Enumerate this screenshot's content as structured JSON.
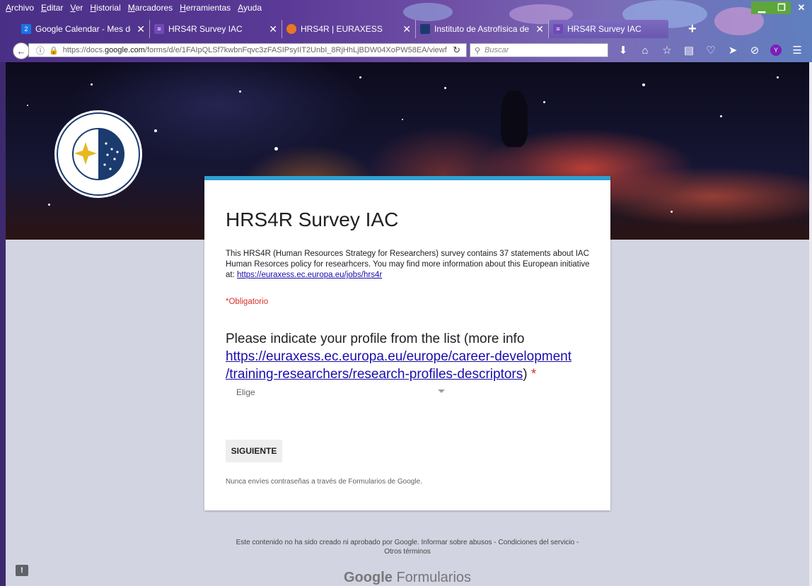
{
  "menubar": {
    "items": [
      "Archivo",
      "Editar",
      "Ver",
      "Historial",
      "Marcadores",
      "Herramientas",
      "Ayuda"
    ]
  },
  "tabs": [
    {
      "title": "Google Calendar - Mes de n",
      "icon": "calendar-icon",
      "icon_color": "#1a73e8",
      "icon_text": "2"
    },
    {
      "title": "HRS4R Survey IAC",
      "icon": "forms-icon",
      "icon_color": "#7248b9",
      "icon_text": "≡"
    },
    {
      "title": "HRS4R | EURAXESS",
      "icon": "euraxess-icon",
      "icon_color": "#e87722",
      "icon_text": ""
    },
    {
      "title": "Instituto de Astrofísica de Ca",
      "icon": "iac-icon",
      "icon_color": "#1b3b6f",
      "icon_text": ""
    },
    {
      "title": "HRS4R Survey IAC",
      "icon": "forms-icon",
      "icon_color": "#7248b9",
      "icon_text": "≡"
    }
  ],
  "navbar": {
    "url_prefix": "https://docs.",
    "url_domain": "google.com",
    "url_rest": "/forms/d/e/1FAIpQLSf7kwbnFqvc3zFASIPsyIIT2UnbI_8RjHhLjBDW04XoPW58EA/viewf",
    "search_placeholder": "Buscar",
    "profile_letter": "Y"
  },
  "form": {
    "title": "HRS4R Survey IAC",
    "description": "This HRS4R (Human Resources Strategy for Researchers) survey contains 37 statements about IAC Human Resorces policy for researhcers. You may find more information about this European initiative at: ",
    "description_link": "https://euraxess.ec.europa.eu/jobs/hrs4r",
    "required_note": "*Obligatorio",
    "question_text": "Please indicate your profile from the list (more info ",
    "question_link_1": "https://euraxess.ec.europa.eu/europe/career-development",
    "question_link_2": "/training-researchers/research-profiles-descriptors",
    "question_close": ")",
    "question_required": "*",
    "dropdown_value": "Elige",
    "next_button": "SIGUIENTE",
    "password_warning": "Nunca envíes contraseñas a través de Formularios de Google."
  },
  "footer": {
    "disclaimer": "Este contenido no ha sido creado ni aprobado por Google. Informar sobre abusos - Condiciones del servicio -",
    "other_terms": "Otros términos",
    "brand_google": "Google",
    "brand_product": "Formularios"
  },
  "colors": {
    "accent": "#2f9ecf",
    "required": "#d93025",
    "link": "#1a0dab",
    "page_bg": "#d3d4e2"
  }
}
